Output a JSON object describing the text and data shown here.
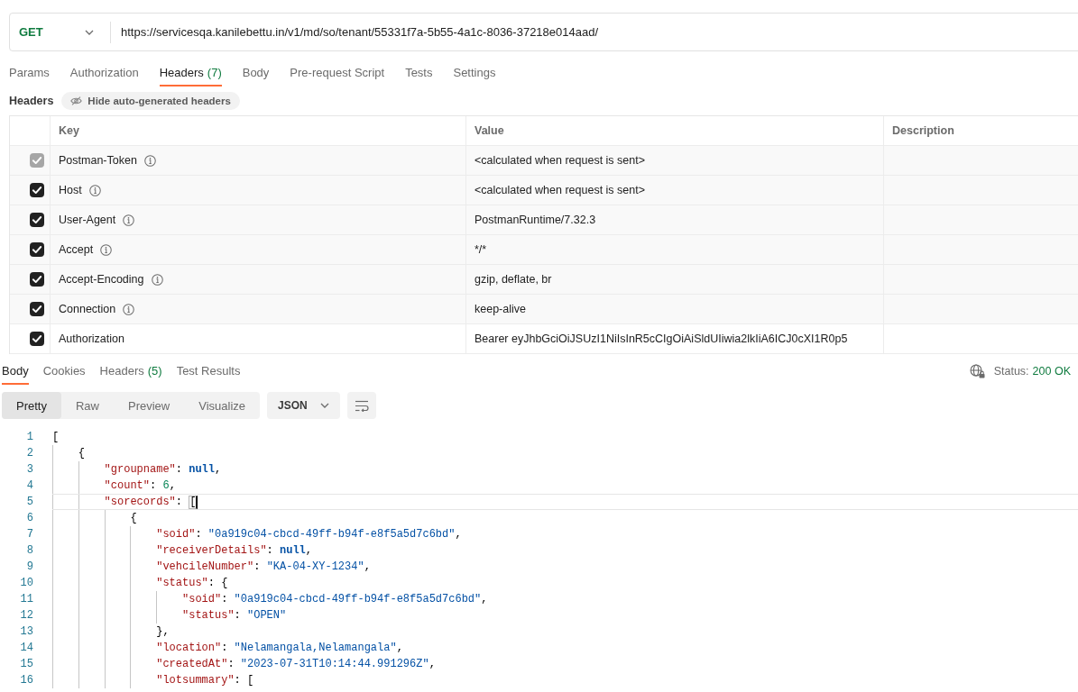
{
  "request": {
    "method": "GET",
    "url": "https://servicesqa.kanilebettu.in/v1/md/so/tenant/55331f7a-5b55-4a1c-8036-37218e014aad/"
  },
  "request_tabs": [
    {
      "label": "Params",
      "selected": false
    },
    {
      "label": "Authorization",
      "selected": false
    },
    {
      "label": "Headers",
      "count": "(7)",
      "selected": true
    },
    {
      "label": "Body",
      "selected": false
    },
    {
      "label": "Pre-request Script",
      "selected": false
    },
    {
      "label": "Tests",
      "selected": false
    },
    {
      "label": "Settings",
      "selected": false
    }
  ],
  "headers_section": {
    "title": "Headers",
    "toggle_button": "Hide auto-generated headers"
  },
  "headers_table": {
    "columns": [
      "Key",
      "Value",
      "Description"
    ],
    "rows": [
      {
        "kind": "auto",
        "checked": true,
        "disabled": true,
        "key": "Postman-Token",
        "value": "<calculated when request is sent>"
      },
      {
        "kind": "auto",
        "checked": true,
        "disabled": false,
        "key": "Host",
        "value": "<calculated when request is sent>"
      },
      {
        "kind": "auto",
        "checked": true,
        "disabled": false,
        "key": "User-Agent",
        "value": "PostmanRuntime/7.32.3"
      },
      {
        "kind": "auto",
        "checked": true,
        "disabled": false,
        "key": "Accept",
        "value": "*/*"
      },
      {
        "kind": "auto",
        "checked": true,
        "disabled": false,
        "key": "Accept-Encoding",
        "value": "gzip, deflate, br"
      },
      {
        "kind": "auto",
        "checked": true,
        "disabled": false,
        "key": "Connection",
        "value": "keep-alive"
      },
      {
        "kind": "user",
        "checked": true,
        "disabled": false,
        "key": "Authorization",
        "value": "Bearer eyJhbGciOiJSUzI1NiIsInR5cCIgOiAiSldUIiwia2lkIiA6ICJ0cXI1R0p5"
      }
    ]
  },
  "response_tabs": [
    {
      "label": "Body",
      "selected": true
    },
    {
      "label": "Cookies",
      "selected": false
    },
    {
      "label": "Headers",
      "count": "(5)",
      "selected": false
    },
    {
      "label": "Test Results",
      "selected": false
    }
  ],
  "response_status": {
    "label": "Status:",
    "value": "200 OK"
  },
  "view_modes": [
    {
      "label": "Pretty",
      "selected": true
    },
    {
      "label": "Raw",
      "selected": false
    },
    {
      "label": "Preview",
      "selected": false
    },
    {
      "label": "Visualize",
      "selected": false
    }
  ],
  "format_dropdown": {
    "value": "JSON"
  },
  "code": {
    "lines": [
      {
        "number": "1",
        "current": false,
        "tokens": [
          {
            "kind": "punct",
            "text": "["
          }
        ],
        "children": [
          {
            "number": "2",
            "current": false,
            "tokens": [
              {
                "kind": "punct",
                "text": "{"
              }
            ],
            "children": [
              {
                "number": "3",
                "current": false,
                "tokens": [
                  {
                    "kind": "key",
                    "text": "\"groupname\""
                  },
                  {
                    "kind": "punct",
                    "text": ": "
                  },
                  {
                    "kind": "literal",
                    "text": "null"
                  },
                  {
                    "kind": "punct",
                    "text": ","
                  }
                ]
              },
              {
                "number": "4",
                "current": false,
                "tokens": [
                  {
                    "kind": "key",
                    "text": "\"count\""
                  },
                  {
                    "kind": "punct",
                    "text": ": "
                  },
                  {
                    "kind": "number",
                    "text": "6"
                  },
                  {
                    "kind": "punct",
                    "text": ","
                  }
                ]
              },
              {
                "number": "5",
                "current": true,
                "tokens": [
                  {
                    "kind": "key",
                    "text": "\"sorecords\""
                  },
                  {
                    "kind": "punct",
                    "text": ": "
                  },
                  {
                    "kind": "match",
                    "text": "["
                  }
                ],
                "children": [
                  {
                    "number": "6",
                    "current": false,
                    "tokens": [
                      {
                        "kind": "punct",
                        "text": "{"
                      }
                    ],
                    "children": [
                      {
                        "number": "7",
                        "current": false,
                        "tokens": [
                          {
                            "kind": "key",
                            "text": "\"soid\""
                          },
                          {
                            "kind": "punct",
                            "text": ": "
                          },
                          {
                            "kind": "string",
                            "text": "\"0a919c04-cbcd-49ff-b94f-e8f5a5d7c6bd\""
                          },
                          {
                            "kind": "punct",
                            "text": ","
                          }
                        ]
                      },
                      {
                        "number": "8",
                        "current": false,
                        "tokens": [
                          {
                            "kind": "key",
                            "text": "\"receiverDetails\""
                          },
                          {
                            "kind": "punct",
                            "text": ": "
                          },
                          {
                            "kind": "literal",
                            "text": "null"
                          },
                          {
                            "kind": "punct",
                            "text": ","
                          }
                        ]
                      },
                      {
                        "number": "9",
                        "current": false,
                        "tokens": [
                          {
                            "kind": "key",
                            "text": "\"vehcileNumber\""
                          },
                          {
                            "kind": "punct",
                            "text": ": "
                          },
                          {
                            "kind": "string",
                            "text": "\"KA-04-XY-1234\""
                          },
                          {
                            "kind": "punct",
                            "text": ","
                          }
                        ]
                      },
                      {
                        "number": "10",
                        "current": false,
                        "tokens": [
                          {
                            "kind": "key",
                            "text": "\"status\""
                          },
                          {
                            "kind": "punct",
                            "text": ": {"
                          }
                        ],
                        "children": [
                          {
                            "number": "11",
                            "current": false,
                            "tokens": [
                              {
                                "kind": "key",
                                "text": "\"soid\""
                              },
                              {
                                "kind": "punct",
                                "text": ": "
                              },
                              {
                                "kind": "string",
                                "text": "\"0a919c04-cbcd-49ff-b94f-e8f5a5d7c6bd\""
                              },
                              {
                                "kind": "punct",
                                "text": ","
                              }
                            ]
                          },
                          {
                            "number": "12",
                            "current": false,
                            "tokens": [
                              {
                                "kind": "key",
                                "text": "\"status\""
                              },
                              {
                                "kind": "punct",
                                "text": ": "
                              },
                              {
                                "kind": "string",
                                "text": "\"OPEN\""
                              }
                            ]
                          }
                        ]
                      },
                      {
                        "number": "13",
                        "current": false,
                        "tokens": [
                          {
                            "kind": "punct",
                            "text": "},"
                          }
                        ]
                      },
                      {
                        "number": "14",
                        "current": false,
                        "tokens": [
                          {
                            "kind": "key",
                            "text": "\"location\""
                          },
                          {
                            "kind": "punct",
                            "text": ": "
                          },
                          {
                            "kind": "string",
                            "text": "\"Nelamangala,Nelamangala\""
                          },
                          {
                            "kind": "punct",
                            "text": ","
                          }
                        ]
                      },
                      {
                        "number": "15",
                        "current": false,
                        "tokens": [
                          {
                            "kind": "key",
                            "text": "\"createdAt\""
                          },
                          {
                            "kind": "punct",
                            "text": ": "
                          },
                          {
                            "kind": "string",
                            "text": "\"2023-07-31T10:14:44.991296Z\""
                          },
                          {
                            "kind": "punct",
                            "text": ","
                          }
                        ]
                      },
                      {
                        "number": "16",
                        "current": false,
                        "tokens": [
                          {
                            "kind": "key",
                            "text": "\"lotsummary\""
                          },
                          {
                            "kind": "punct",
                            "text": ": ["
                          }
                        ]
                      }
                    ]
                  }
                ]
              }
            ]
          }
        ]
      }
    ]
  }
}
